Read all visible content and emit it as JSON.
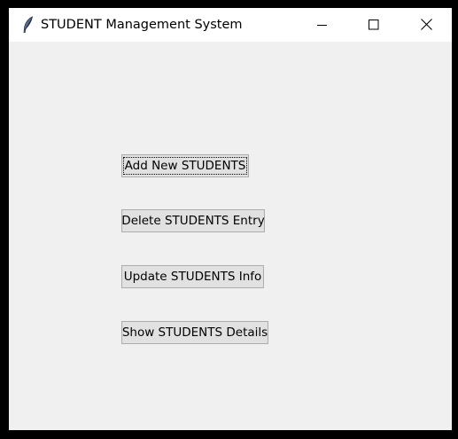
{
  "window": {
    "title": "STUDENT Management System",
    "controls": {
      "minimize_icon": "minimize-icon",
      "maximize_icon": "maximize-icon",
      "close_icon": "close-icon"
    },
    "app_icon": "feather-icon"
  },
  "buttons": {
    "add_label": "Add New STUDENTS",
    "delete_label": "Delete STUDENTS Entry",
    "update_label": "Update STUDENTS Info",
    "show_label": "Show STUDENTS Details"
  },
  "colors": {
    "window_background": "#f0f0f0",
    "titlebar_background": "#ffffff",
    "button_background": "#e1e1e1",
    "button_border": "#adadad"
  }
}
